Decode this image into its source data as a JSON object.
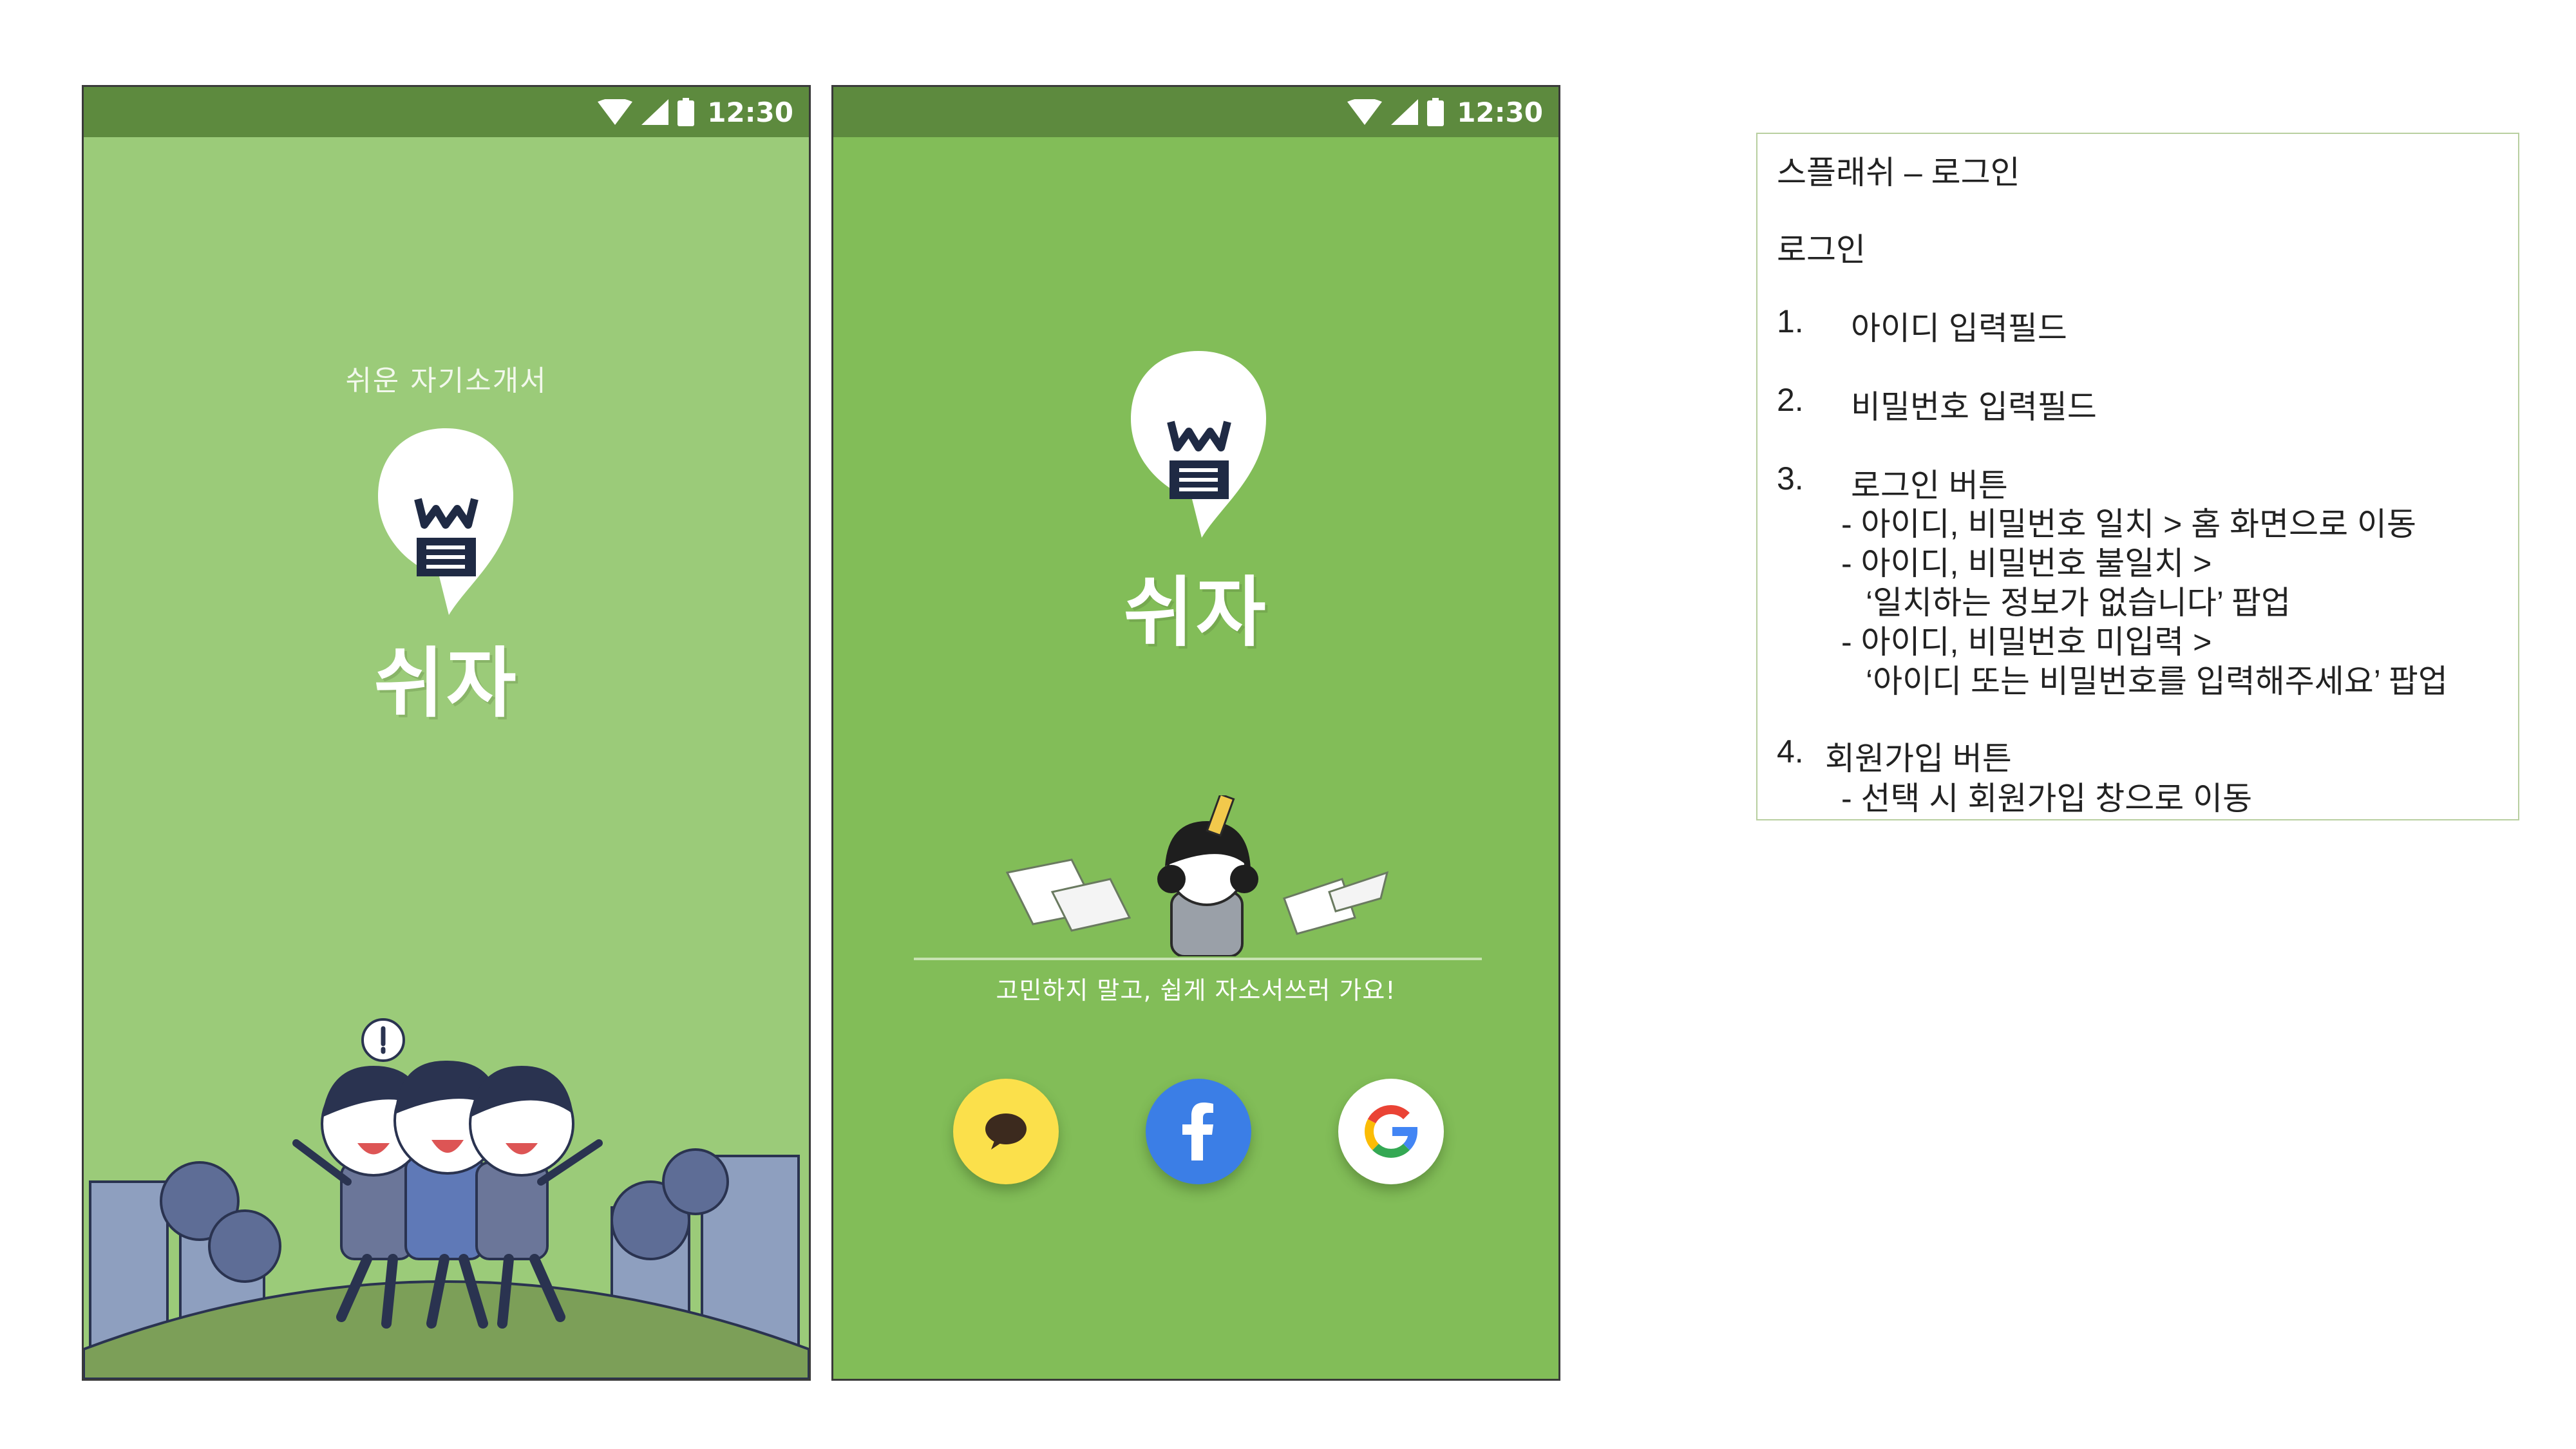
{
  "status_bar": {
    "time": "12:30"
  },
  "splash": {
    "slogan": "쉬운 자기소개서",
    "logo_text": "쉬자"
  },
  "login": {
    "logo_text": "쉬자",
    "tagline": "고민하지 말고, 쉽게 자소서쓰러 가요!",
    "social_buttons": [
      {
        "name": "kakao",
        "icon": "speech-bubble-icon",
        "color": "#fbe04b"
      },
      {
        "name": "facebook",
        "icon": "facebook-f-icon",
        "color": "#3b7ee6"
      },
      {
        "name": "google",
        "icon": "google-g-icon",
        "color": "#ffffff"
      }
    ]
  },
  "notes": {
    "title": "스플래쉬 – 로그인",
    "section": "로그인",
    "items": [
      {
        "num": "1.",
        "label": "아이디 입력필드"
      },
      {
        "num": "2.",
        "label": "비밀번호 입력필드"
      },
      {
        "num": "3.",
        "label": "로그인 버튼"
      },
      {
        "num": "4.",
        "label": "회원가입 버튼"
      }
    ],
    "item3_details": [
      "- 아이디, 비밀번호 일치 > 홈 화면으로 이동",
      "- 아이디, 비밀번호 불일치 >",
      "‘일치하는 정보가 없습니다’ 팝업",
      "- 아이디, 비밀번호 미입력 >",
      "‘아이디 또는 비밀번호를 입력해주세요’ 팝업"
    ],
    "item4_details": [
      "- 선택 시 회원가입 창으로 이동"
    ]
  },
  "colors": {
    "splash_bg": "#9bcb79",
    "login_bg": "#82bd58",
    "status_bar": "#5d8a3e",
    "ground": "#7c9f58",
    "buildings": "#8e9fbf"
  }
}
